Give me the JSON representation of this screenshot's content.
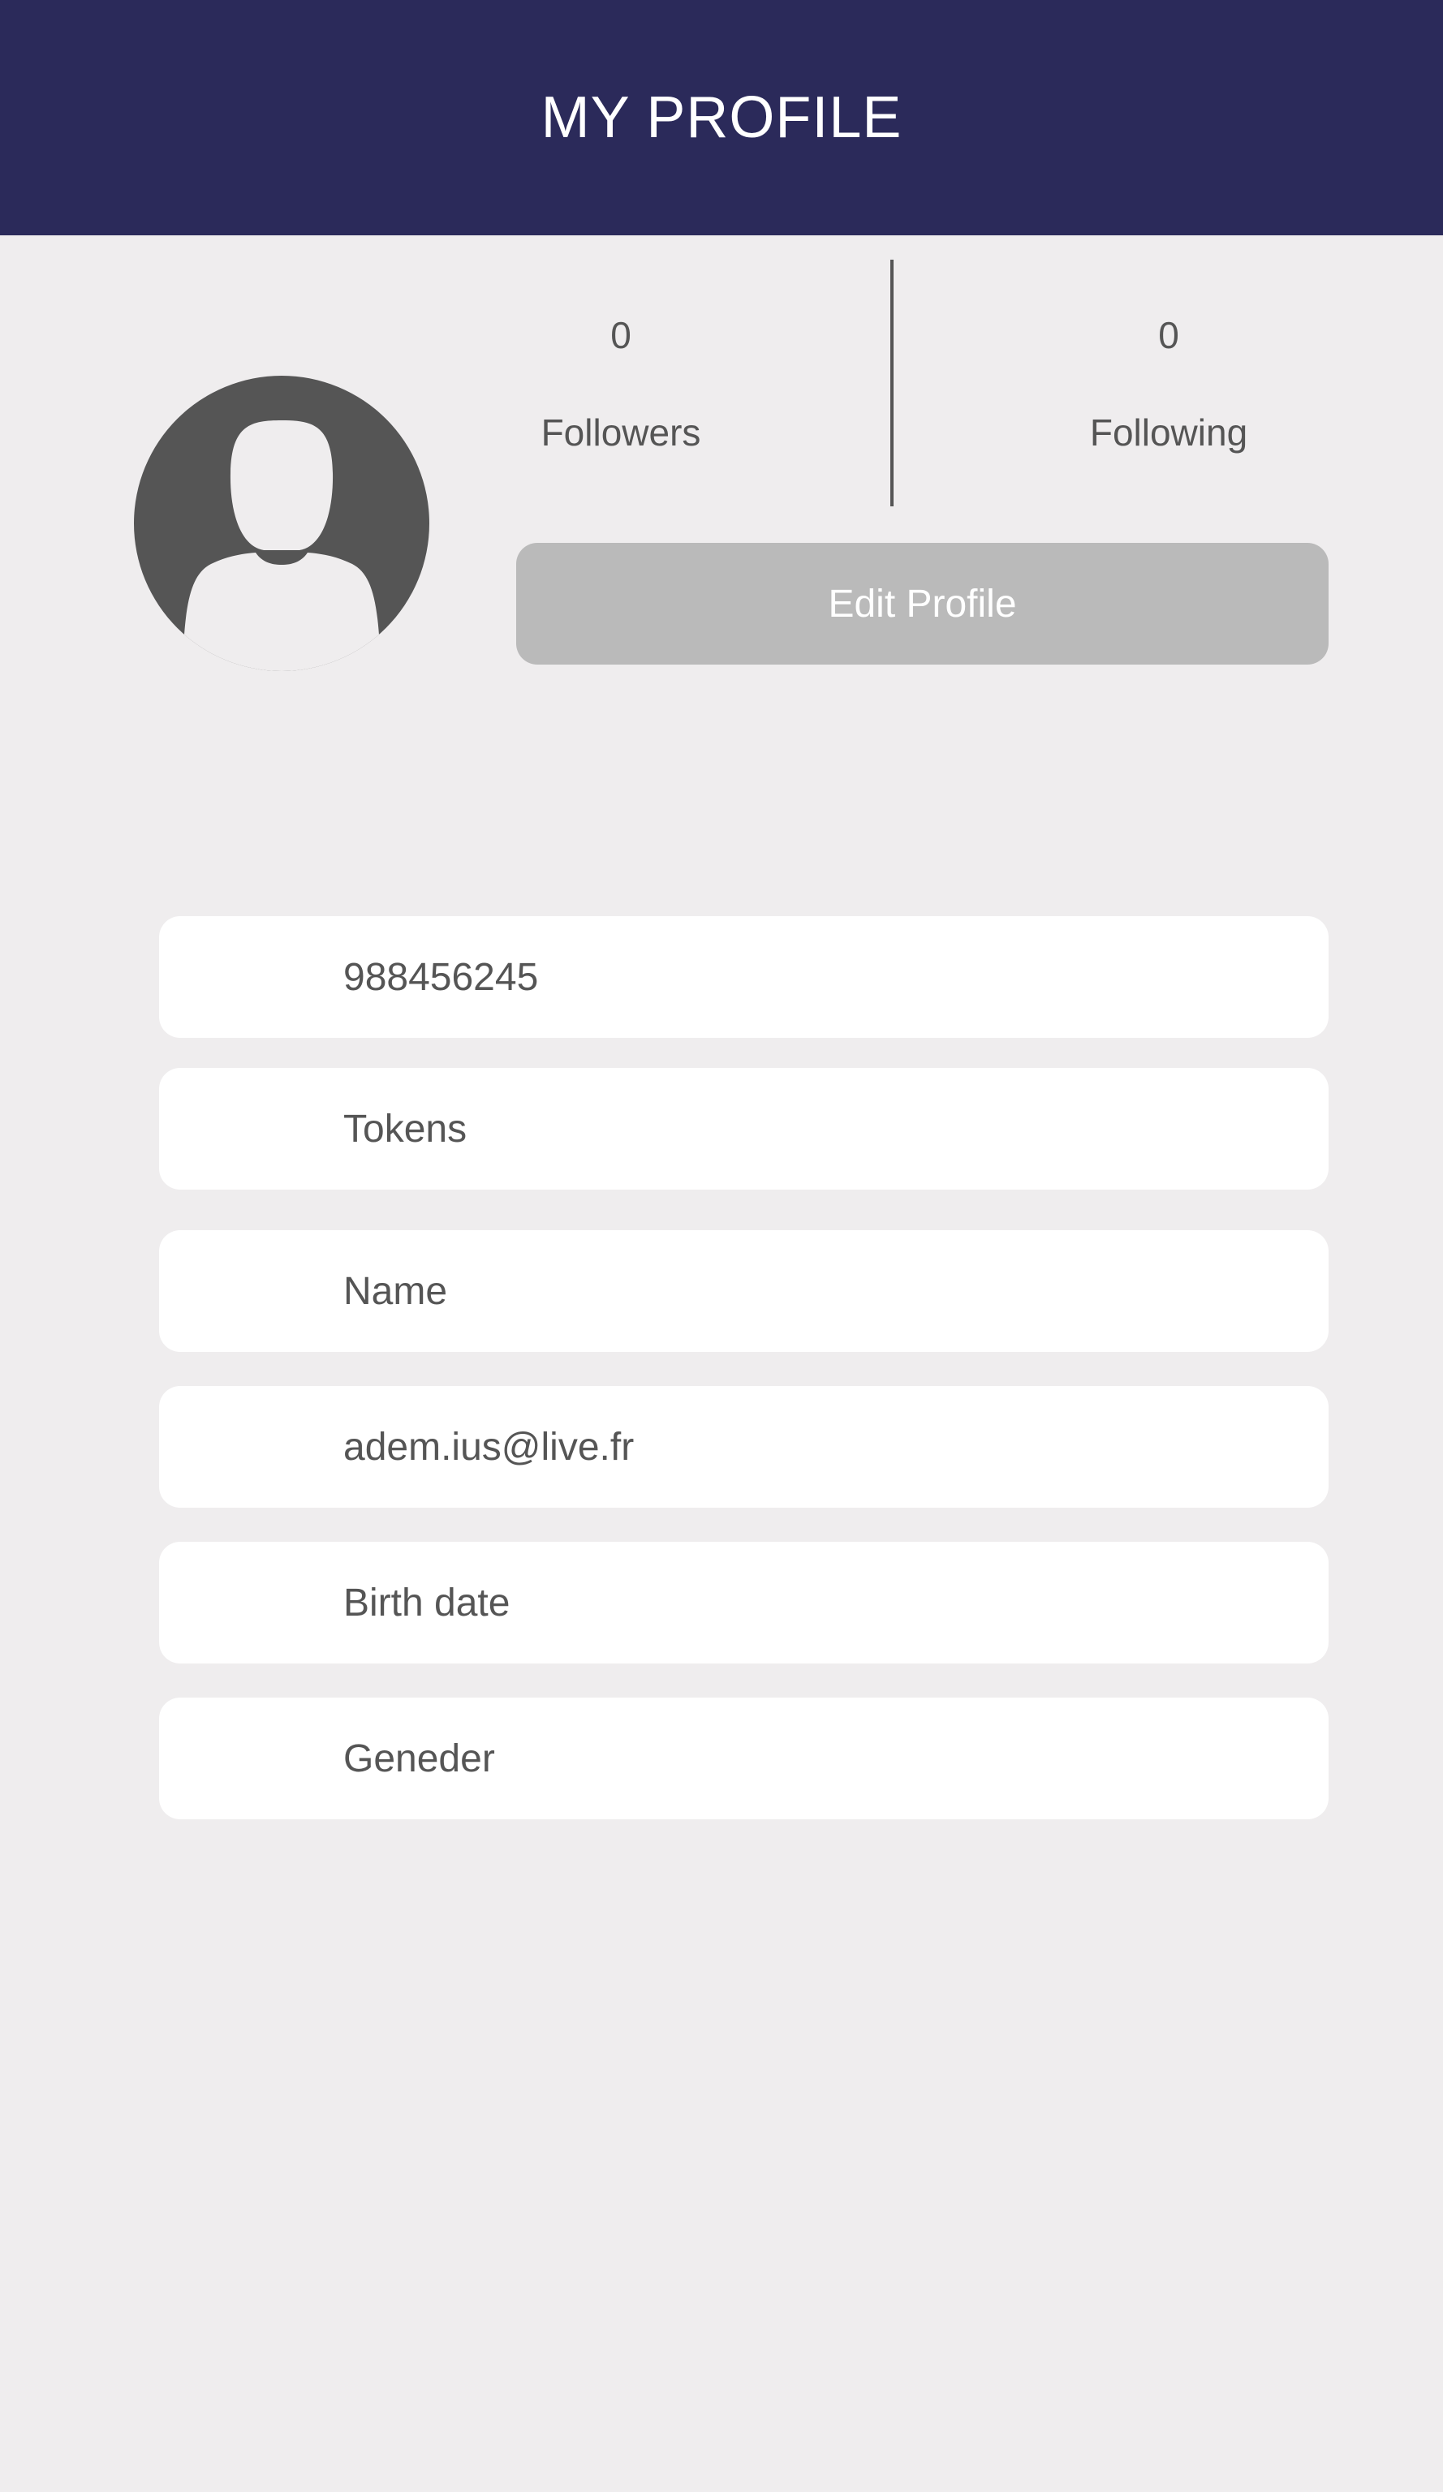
{
  "header": {
    "title": "MY PROFILE"
  },
  "stats": {
    "followers": {
      "count": "0",
      "label": "Followers"
    },
    "following": {
      "count": "0",
      "label": "Following"
    }
  },
  "edit_button": {
    "label": "Edit Profile"
  },
  "fields": [
    {
      "value": "988456245"
    },
    {
      "value": "Tokens"
    },
    {
      "value": "Name"
    },
    {
      "value": "adem.ius@live.fr"
    },
    {
      "value": "Birth date"
    },
    {
      "value": "Geneder"
    }
  ],
  "colors": {
    "header_bg": "#2b2a5a",
    "background": "#efedee",
    "button_bg": "#bababa",
    "avatar": "#555555"
  }
}
